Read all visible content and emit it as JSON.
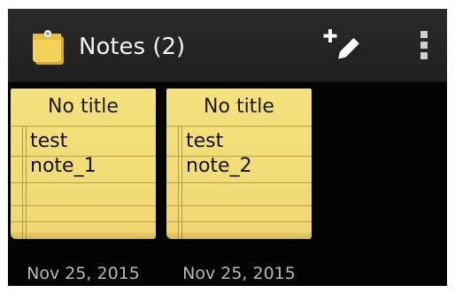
{
  "action_bar": {
    "title": "Notes (2)",
    "app_icon": "sticky-notes-app-icon",
    "new_note_icon": "add-note-pencil-icon",
    "overflow_icon": "vertical-dots-menu-icon"
  },
  "notes": [
    {
      "title": "No title",
      "lines": [
        "test",
        "note_1"
      ],
      "date": "Nov 25, 2015"
    },
    {
      "title": "No title",
      "lines": [
        "test",
        "note_2"
      ],
      "date": "Nov 25, 2015"
    }
  ],
  "colors": {
    "note_paper": "#f2dd78",
    "action_bar": "#252525",
    "background": "#000000",
    "date_text": "#b7b7b7"
  }
}
